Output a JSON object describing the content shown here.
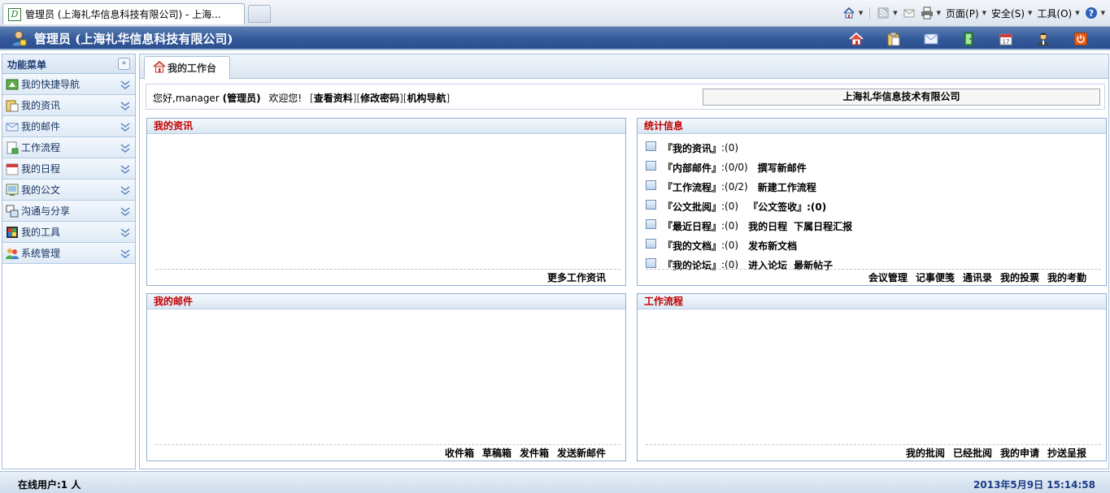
{
  "browser": {
    "tab_title": "管理员 (上海礼华信息科技有限公司) - 上海...",
    "commands": [
      {
        "label": "",
        "icon": "home-icon"
      },
      {
        "label": "",
        "icon": "rss-feed-icon"
      },
      {
        "label": "",
        "icon": "mail-read-icon"
      },
      {
        "label": "",
        "icon": "print-icon"
      },
      {
        "label": "页面(P)",
        "icon": ""
      },
      {
        "label": "安全(S)",
        "icon": ""
      },
      {
        "label": "工具(O)",
        "icon": ""
      },
      {
        "label": "",
        "icon": "help-icon"
      }
    ]
  },
  "header": {
    "title": "管理员 (上海礼华信息科技有限公司)",
    "icons": [
      "home-icon",
      "clipboard-icon",
      "mail-icon",
      "door-exit-icon",
      "calendar-icon",
      "user-avatar-icon",
      "power-icon"
    ],
    "accent": "#2f5593"
  },
  "sidebar": {
    "title": "功能菜单",
    "collapse_glyph": "«",
    "items": [
      {
        "label": "我的快捷导航",
        "icon": "shortcut-nav-icon"
      },
      {
        "label": "我的资讯",
        "icon": "news-clipboard-icon"
      },
      {
        "label": "我的邮件",
        "icon": "envelope-icon"
      },
      {
        "label": "工作流程",
        "icon": "workflow-icon"
      },
      {
        "label": "我的日程",
        "icon": "schedule-calendar-icon"
      },
      {
        "label": "我的公文",
        "icon": "document-icon"
      },
      {
        "label": "沟通与分享",
        "icon": "share-icon"
      },
      {
        "label": "我的工具",
        "icon": "tools-grid-icon"
      },
      {
        "label": "系统管理",
        "icon": "system-users-icon"
      }
    ]
  },
  "main": {
    "tab_label": "我的工作台",
    "welcome": {
      "greeting": "您好,manager",
      "role": "(管理员)",
      "welcome_text": "欢迎您!",
      "links": [
        "查看资料",
        "修改密码",
        "机构导航"
      ],
      "company": "上海礼华信息技术有限公司"
    },
    "panels": {
      "news": {
        "title": "我的资讯",
        "footer_links": [
          "更多工作资讯"
        ]
      },
      "stats": {
        "title": "统计信息",
        "rows": [
          {
            "name": "『我的资讯』",
            "count": ":(0)",
            "actions": []
          },
          {
            "name": "『内部邮件』",
            "count": ":(0/0)",
            "actions": [
              "撰写新邮件"
            ]
          },
          {
            "name": "『工作流程』",
            "count": ":(0/2)",
            "actions": [
              "新建工作流程"
            ]
          },
          {
            "name": "『公文批阅』",
            "count": ":(0)",
            "actions": [
              "『公文签收』:(0)"
            ]
          },
          {
            "name": "『最近日程』",
            "count": ":(0)",
            "actions": [
              "我的日程",
              "下属日程汇报"
            ]
          },
          {
            "name": "『我的文档』",
            "count": ":(0)",
            "actions": [
              "发布新文档"
            ]
          },
          {
            "name": "『我的论坛』",
            "count": ":(0)",
            "actions": [
              "进入论坛",
              "最新帖子"
            ]
          }
        ],
        "footer_links": [
          "会议管理",
          "记事便笺",
          "通讯录",
          "我的投票",
          "我的考勤"
        ]
      },
      "mail": {
        "title": "我的邮件",
        "footer_links": [
          "收件箱",
          "草稿箱",
          "发件箱",
          "发送新邮件"
        ]
      },
      "workflow": {
        "title": "工作流程",
        "footer_links": [
          "我的批阅",
          "已经批阅",
          "我的申请",
          "抄送呈报"
        ]
      }
    }
  },
  "status": {
    "online": "在线用户:1 人",
    "datetime": "2013年5月9日 15:14:58"
  }
}
